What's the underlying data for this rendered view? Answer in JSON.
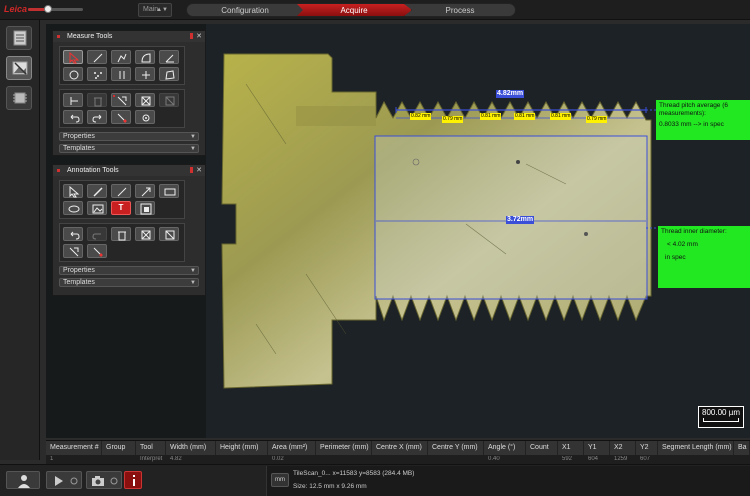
{
  "app": {
    "logo": "Leica",
    "workspace": "Main"
  },
  "workflow_tabs": [
    "Configuration",
    "Acquire",
    "Process"
  ],
  "measure_tools": {
    "title": "Measure Tools",
    "properties": "Properties",
    "templates": "Templates"
  },
  "annotation_tools": {
    "title": "Annotation Tools",
    "properties": "Properties",
    "templates": "Templates",
    "text_tool": "T"
  },
  "image_annotations": {
    "length_top": "4.82mm",
    "length_inner": "3.72mm",
    "pitch_labels": [
      "0.82 mm",
      "0.79 mm",
      "0.81 mm",
      "0.81 mm",
      "0.81 mm",
      "0.79 mm"
    ],
    "pitch_box_line1": "Thread pitch average (6",
    "pitch_box_line2": "measurements):",
    "pitch_box_line3": "0.8033 mm --> in spec",
    "diameter_box_line1": "Thread inner diameter:",
    "diameter_box_line2": "< 4.02 mm",
    "diameter_box_line3": "in spec",
    "scale_bar": "800.00 µm"
  },
  "table": {
    "columns": [
      "Measurement #",
      "Group",
      "Tool",
      "Width (mm)",
      "Height (mm)",
      "Area (mm²)",
      "Perimeter (mm)",
      "Centre X (mm)",
      "Centre Y (mm)",
      "Angle (°)",
      "Count",
      "X1",
      "Y1",
      "X2",
      "Y2",
      "Segment Length (mm)",
      "Ba"
    ],
    "row": [
      "1",
      "",
      "Interpret",
      "4.82",
      "",
      "0.02",
      "",
      "",
      "",
      "0.40",
      "",
      "592",
      "604",
      "1259",
      "607",
      "",
      ""
    ]
  },
  "status": {
    "unit": "mm",
    "line1": "TileScan_0... x=11583 y=8583  (284.4 MB)",
    "line2": "Size: 12.5 mm x 9.26 mm"
  }
}
